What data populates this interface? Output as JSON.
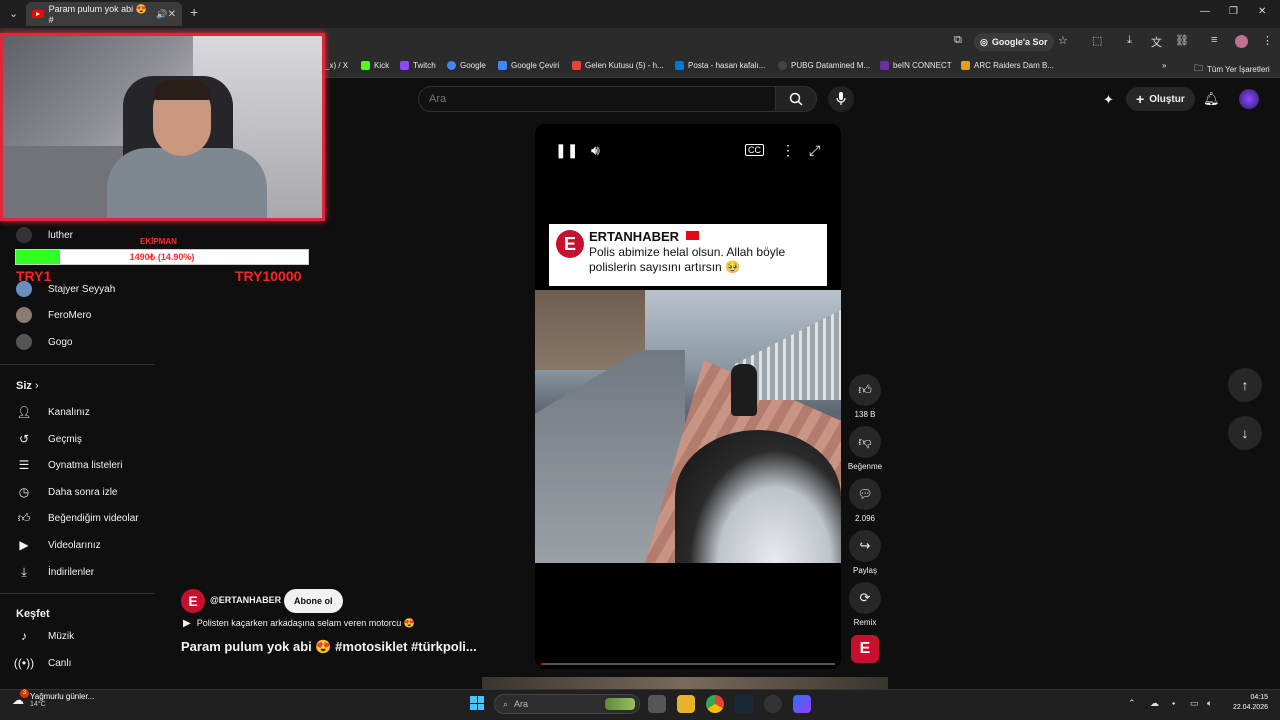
{
  "browser": {
    "tab_title": "Param pulum yok abi 😍 #",
    "google_sor": "Google'a Sor",
    "bookmarks": [
      {
        "label": "_x) / X",
        "color": "#000000"
      },
      {
        "label": "Kick",
        "color": "#53fc18"
      },
      {
        "label": "Twitch",
        "color": "#9146ff"
      },
      {
        "label": "Google",
        "color": "#4285f4"
      },
      {
        "label": "Google Çeviri",
        "color": "#4285f4"
      },
      {
        "label": "Gelen Kutusu (5) - h...",
        "color": "#ea4335"
      },
      {
        "label": "Posta - hasan kafalı...",
        "color": "#0078d4"
      },
      {
        "label": "PUBG Datamined M...",
        "color": "#222222"
      },
      {
        "label": "beIN CONNECT",
        "color": "#6b2fa0"
      },
      {
        "label": "ARC Raiders Dam B...",
        "color": "#e0a020"
      }
    ],
    "all_bookmarks": "Tüm Yer İşaretleri"
  },
  "header": {
    "search_placeholder": "Ara",
    "create_label": "Oluştur"
  },
  "sidebar": {
    "subscriptions": [
      {
        "label": "luther"
      },
      {
        "label": "Stajyer Seyyah"
      },
      {
        "label": "FeroMero"
      },
      {
        "label": "Gogo"
      }
    ],
    "you_heading": "Siz",
    "you_items": [
      {
        "label": "Kanalınız",
        "icon": "channel-icon"
      },
      {
        "label": "Geçmiş",
        "icon": "history-icon"
      },
      {
        "label": "Oynatma listeleri",
        "icon": "playlist-icon"
      },
      {
        "label": "Daha sonra izle",
        "icon": "clock-icon"
      },
      {
        "label": "Beğendiğim videolar",
        "icon": "thumb-up-icon"
      },
      {
        "label": "Videolarınız",
        "icon": "video-icon"
      },
      {
        "label": "İndirilenler",
        "icon": "download-icon"
      }
    ],
    "explore_heading": "Keşfet",
    "explore_items": [
      {
        "label": "Müzik",
        "icon": "music-icon"
      },
      {
        "label": "Canlı",
        "icon": "live-icon"
      }
    ]
  },
  "overlay": {
    "ekipman": "EKİPMAN",
    "progress_text": "1490₺ (14.90%)",
    "progress_fraction": 0.149,
    "min_label": "TRY1",
    "max_label": "TRY10000"
  },
  "video": {
    "news_name": "ERTANHABER",
    "news_text": "Polis abimize helal olsun. Allah böyle polislerin sayısını artırsın 🥹",
    "progress_fraction": 0.01
  },
  "actions": {
    "like_count": "138 B",
    "dislike_label": "Beğenme",
    "comment_count": "2.096",
    "share_label": "Paylaş",
    "remix_label": "Remix"
  },
  "meta": {
    "channel": "@ERTANHABER",
    "subscribe": "Abone ol",
    "description": "Polisten kaçarken arkadaşına selam veren motorcu 😍",
    "title": "Param pulum yok abi 😍 #motosiklet  #türkpoli..."
  },
  "taskbar": {
    "weather_title": "Yağmurlu günler...",
    "weather_temp": "14°C",
    "weather_badge": "3",
    "search_placeholder": "Ara",
    "time": "04:15",
    "date": "22.04.2026"
  }
}
